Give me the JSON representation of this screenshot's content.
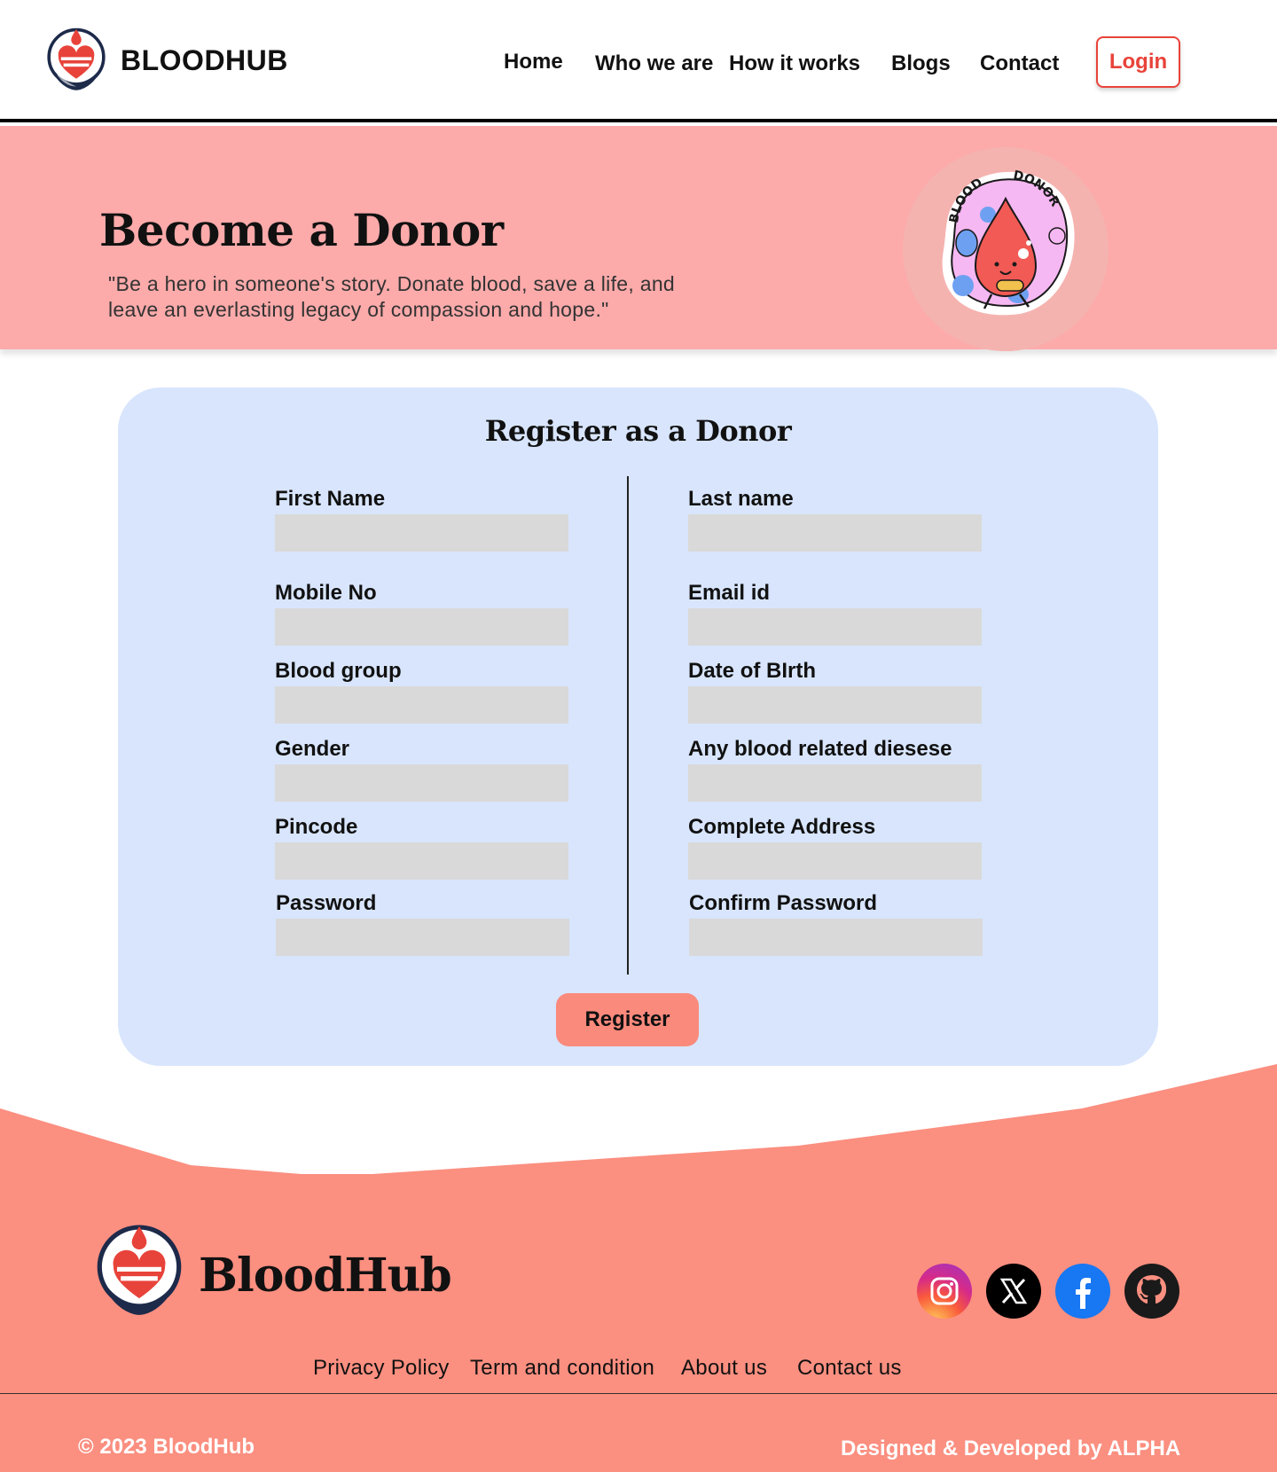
{
  "header": {
    "brand_name": "BLOODHUB",
    "nav": [
      "Home",
      "Who we are",
      "How it works",
      "Blogs",
      "Contact"
    ],
    "login_label": "Login"
  },
  "hero": {
    "title": "Become a Donor",
    "quote": "\"Be a hero in someone's story. Donate blood, save a life, and leave an everlasting legacy of compassion and hope.\"",
    "sticker_text_left": "BLOOD",
    "sticker_text_right": "DONOR"
  },
  "form": {
    "title": "Register as a Donor",
    "fields": [
      {
        "label": "First Name",
        "value": ""
      },
      {
        "label": "Last name",
        "value": ""
      },
      {
        "label": "Mobile No",
        "value": ""
      },
      {
        "label": "Email id",
        "value": ""
      },
      {
        "label": "Blood group",
        "value": ""
      },
      {
        "label": "Date of BIrth",
        "value": ""
      },
      {
        "label": "Gender",
        "value": ""
      },
      {
        "label": "Any blood related diesese",
        "value": ""
      },
      {
        "label": "Pincode",
        "value": ""
      },
      {
        "label": "Complete Address",
        "value": ""
      },
      {
        "label": "Password",
        "value": ""
      },
      {
        "label": "Confirm Password",
        "value": ""
      }
    ],
    "register_label": "Register"
  },
  "footer": {
    "brand_name": "BloodHub",
    "social": [
      "instagram-icon",
      "x-icon",
      "facebook-icon",
      "github-icon"
    ],
    "links": [
      "Privacy Policy",
      "Term and condition",
      "About us",
      "Contact us"
    ],
    "copyright": "© 2023 BloodHub",
    "credit": "Designed & Developed by ALPHA"
  },
  "colors": {
    "accent_red": "#e8433a",
    "hero_bg": "#fcaaaa",
    "card_bg": "#d8e5fd",
    "input_bg": "#d9d9d9",
    "footer_bg": "#fb8f80",
    "register_bg": "#fa8a7c"
  }
}
